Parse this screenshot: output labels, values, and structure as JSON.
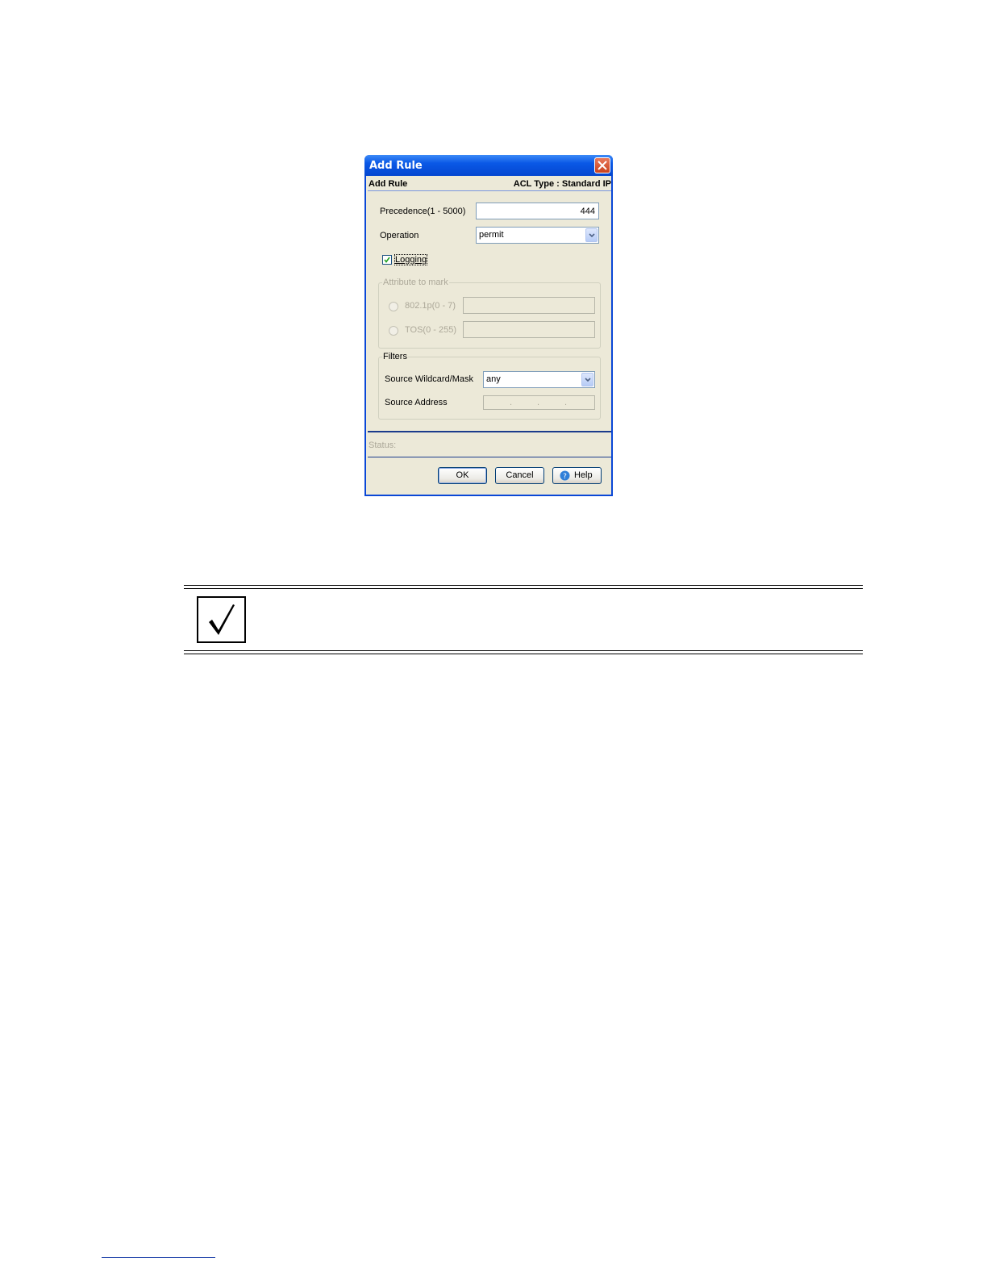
{
  "dialog": {
    "title": "Add Rule",
    "header_left": "Add Rule",
    "header_right": "ACL Type : Standard IP",
    "precedence": {
      "label": "Precedence(1 - 5000)",
      "value": "444"
    },
    "operation": {
      "label": "Operation",
      "value": "permit"
    },
    "logging": {
      "label": "Logging",
      "checked": true
    },
    "attribute_group": {
      "legend": "Attribute to mark",
      "dot1p_label": "802.1p(0 - 7)",
      "tos_label": "TOS(0 - 255)"
    },
    "filters_group": {
      "legend": "Filters",
      "source_wildcard": {
        "label": "Source Wildcard/Mask",
        "value": "any"
      },
      "source_address": {
        "label": "Source Address"
      }
    },
    "status_label": "Status:",
    "buttons": {
      "ok": "OK",
      "cancel": "Cancel",
      "help": "Help"
    }
  },
  "icons": {
    "close": "close-icon",
    "dropdown": "chevron-down-icon",
    "help": "help-icon",
    "note": "checkmark-icon"
  },
  "colors": {
    "titlebar": "#0a58e6",
    "dialog_bg": "#ece9d8",
    "close_button": "#c9411c"
  }
}
